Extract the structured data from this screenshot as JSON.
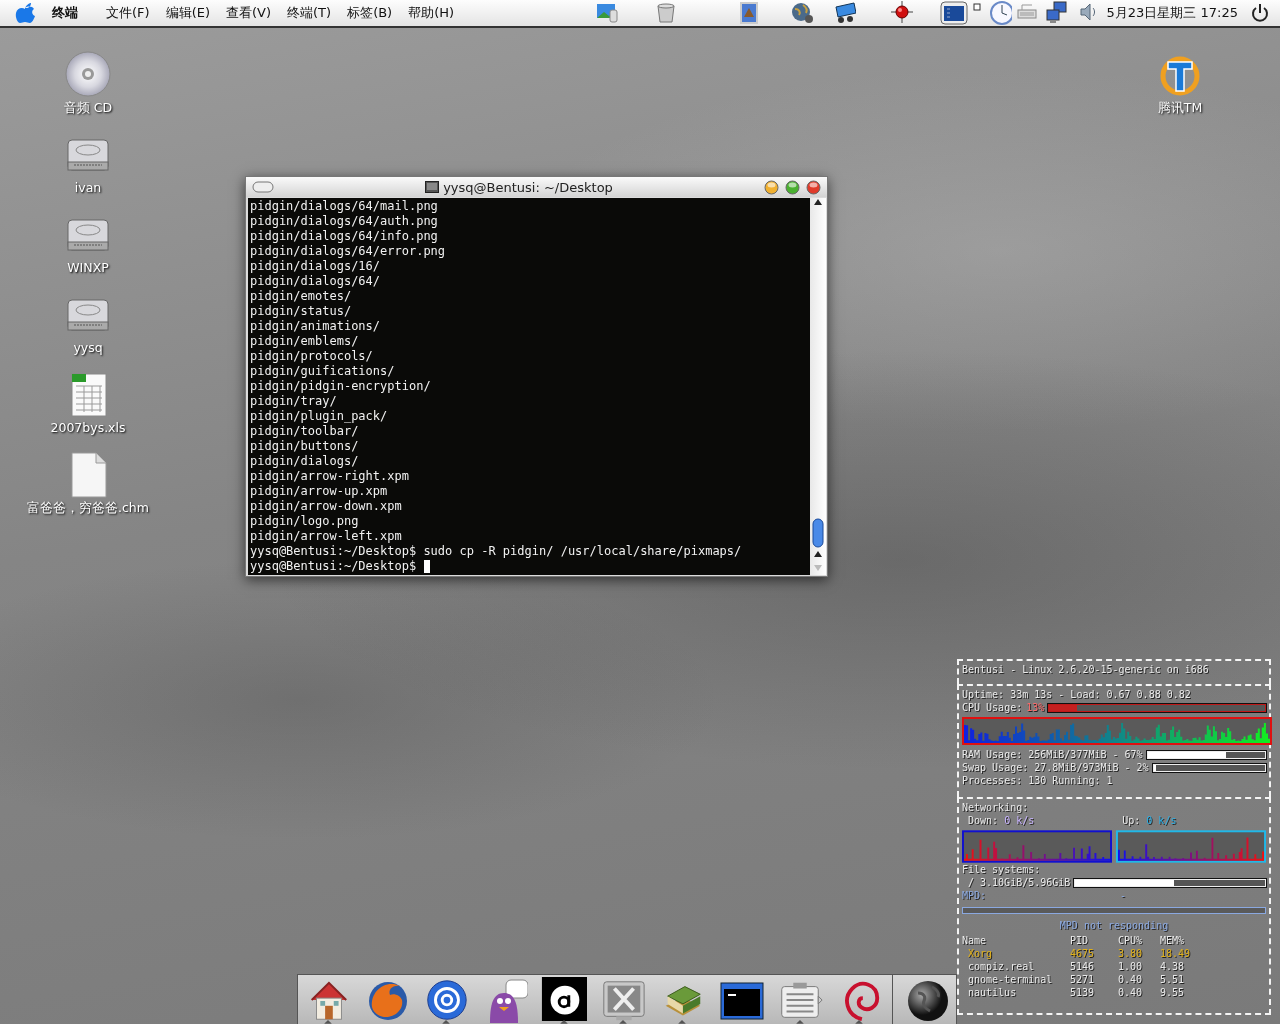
{
  "menubar": {
    "app_name": "终端",
    "menus": [
      "文件(F)",
      "编辑(E)",
      "查看(V)",
      "终端(T)",
      "标签(B)",
      "帮助(H)"
    ],
    "clock": "5月23日星期三 17:25"
  },
  "desktop_icons": {
    "left": [
      {
        "label": "音频 CD",
        "kind": "cd"
      },
      {
        "label": "ivan",
        "kind": "drive"
      },
      {
        "label": "WINXP",
        "kind": "drive"
      },
      {
        "label": "yysq",
        "kind": "drive"
      },
      {
        "label": "2007bys.xls",
        "kind": "spreadsheet"
      },
      {
        "label": "富爸爸，穷爸爸.chm",
        "kind": "document"
      }
    ],
    "right": [
      {
        "label": "腾讯TM",
        "kind": "messenger"
      }
    ]
  },
  "terminal": {
    "title": "yysq@Bentusi: ~/Desktop",
    "lines": [
      "pidgin/dialogs/64/mail.png",
      "pidgin/dialogs/64/auth.png",
      "pidgin/dialogs/64/info.png",
      "pidgin/dialogs/64/error.png",
      "pidgin/dialogs/16/",
      "pidgin/dialogs/64/",
      "pidgin/emotes/",
      "pidgin/status/",
      "pidgin/animations/",
      "pidgin/emblems/",
      "pidgin/protocols/",
      "pidgin/guifications/",
      "pidgin/pidgin-encryption/",
      "pidgin/tray/",
      "pidgin/plugin_pack/",
      "pidgin/toolbar/",
      "pidgin/buttons/",
      "pidgin/dialogs/",
      "pidgin/arrow-right.xpm",
      "pidgin/arrow-up.xpm",
      "pidgin/arrow-down.xpm",
      "pidgin/logo.png",
      "pidgin/arrow-left.xpm",
      "yysq@Bentusi:~/Desktop$ sudo cp -R pidgin/ /usr/local/share/pixmaps/",
      "yysq@Bentusi:~/Desktop$"
    ]
  },
  "conky": {
    "header": "Bentusi - Linux 2.6.20-15-generic on i686",
    "uptime": "Uptime: 33m 13s - Load: 0.67 0.88 0.82",
    "cpu": {
      "label": "CPU Usage:",
      "value": "13%",
      "level": 0.13
    },
    "ram": {
      "label": "RAM Usage: 256MiB/377MiB - 67%",
      "level": 0.67
    },
    "swap": {
      "label": "Swap Usage: 27.8MiB/973MiB - 2%",
      "level": 0.02
    },
    "processes": "Processes: 130  Running: 1",
    "networking": {
      "title": "Networking:",
      "down_label": "Down:",
      "down_value": "0 k/s",
      "up_label": "Up:",
      "up_value": "0 k/s"
    },
    "filesystems": {
      "title": "File systems:",
      "root": {
        "label": "/ 3.10GiB/5.96GiB",
        "level": 0.52
      }
    },
    "mpd": {
      "label": "MPD:",
      "value": "-",
      "status": "MPD not responding"
    },
    "top": {
      "columns": [
        "Name",
        "PID",
        "CPU%",
        "MEM%"
      ],
      "rows": [
        {
          "cells": [
            "Xorg",
            "4675",
            "3.80",
            "18.49"
          ],
          "highlighted": true
        },
        {
          "cells": [
            "compiz.real",
            "5146",
            "1.00",
            "4.38"
          ],
          "highlighted": false
        },
        {
          "cells": [
            "gnome-terminal",
            "5271",
            "0.40",
            "5.51"
          ],
          "highlighted": false
        },
        {
          "cells": [
            "nautilus",
            "5139",
            "0.40",
            "9.55"
          ],
          "highlighted": false
        }
      ]
    }
  },
  "dock": {
    "items": [
      {
        "kind": "home",
        "running": true
      },
      {
        "kind": "browser",
        "running": false
      },
      {
        "kind": "mail",
        "running": true
      },
      {
        "kind": "bird",
        "running": false
      },
      {
        "kind": "letter",
        "running": true
      },
      {
        "kind": "chat",
        "running": true
      },
      {
        "kind": "books",
        "running": true
      },
      {
        "kind": "terminal",
        "running": false
      },
      {
        "kind": "notepad",
        "running": true
      },
      {
        "kind": "swirl",
        "running": true
      },
      {
        "kind": "globe",
        "running": false
      }
    ]
  }
}
